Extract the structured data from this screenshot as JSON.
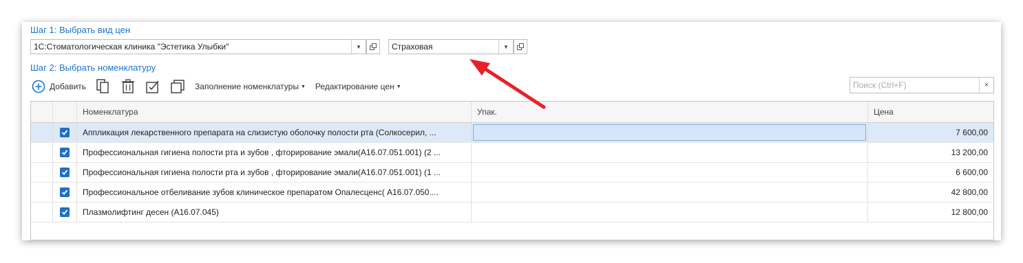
{
  "step1": {
    "title": "Шаг 1: Выбрать вид цен",
    "organization_value": "1С:Стоматологическая клиника \"Эстетика Улыбки\"",
    "price_type_value": "Страховая"
  },
  "step2": {
    "title": "Шаг 2: Выбрать номенклатуру"
  },
  "toolbar": {
    "add_label": "Добавить",
    "fill_label": "Заполнение номенклатуры",
    "edit_prices_label": "Редактирование цен"
  },
  "search": {
    "placeholder": "Поиск (Ctrl+F)",
    "clear_label": "×"
  },
  "table": {
    "columns": [
      "Номенклатура",
      "Упак.",
      "Цена"
    ],
    "rows": [
      {
        "checked": true,
        "name": "Аппликация лекарственного препарата на слизистую оболочку полости рта (Солкосерил, ...",
        "unit": "",
        "price": "7 600,00"
      },
      {
        "checked": true,
        "name": "Профессиональная гигиена полости рта и зубов , фторирование эмали(А16.07.051.001) (2 ...",
        "unit": "",
        "price": "13 200,00"
      },
      {
        "checked": true,
        "name": "Профессиональная гигиена полости рта и зубов , фторирование эмали(А16.07.051.001) (1 ...",
        "unit": "",
        "price": "6 600,00"
      },
      {
        "checked": true,
        "name": "Профессиональное отбеливание зубов клиническое препаратом Опалесценс( А16.07.050....",
        "unit": "",
        "price": "42 800,00"
      },
      {
        "checked": true,
        "name": "Плазмолифтинг десен (А16.07.045)",
        "unit": "",
        "price": "12 800,00"
      }
    ]
  },
  "colors": {
    "accent": "#1e74c8",
    "checkbox": "#1f6fc4",
    "selected_row": "#dde9f7",
    "arrow": "#e8202a"
  }
}
